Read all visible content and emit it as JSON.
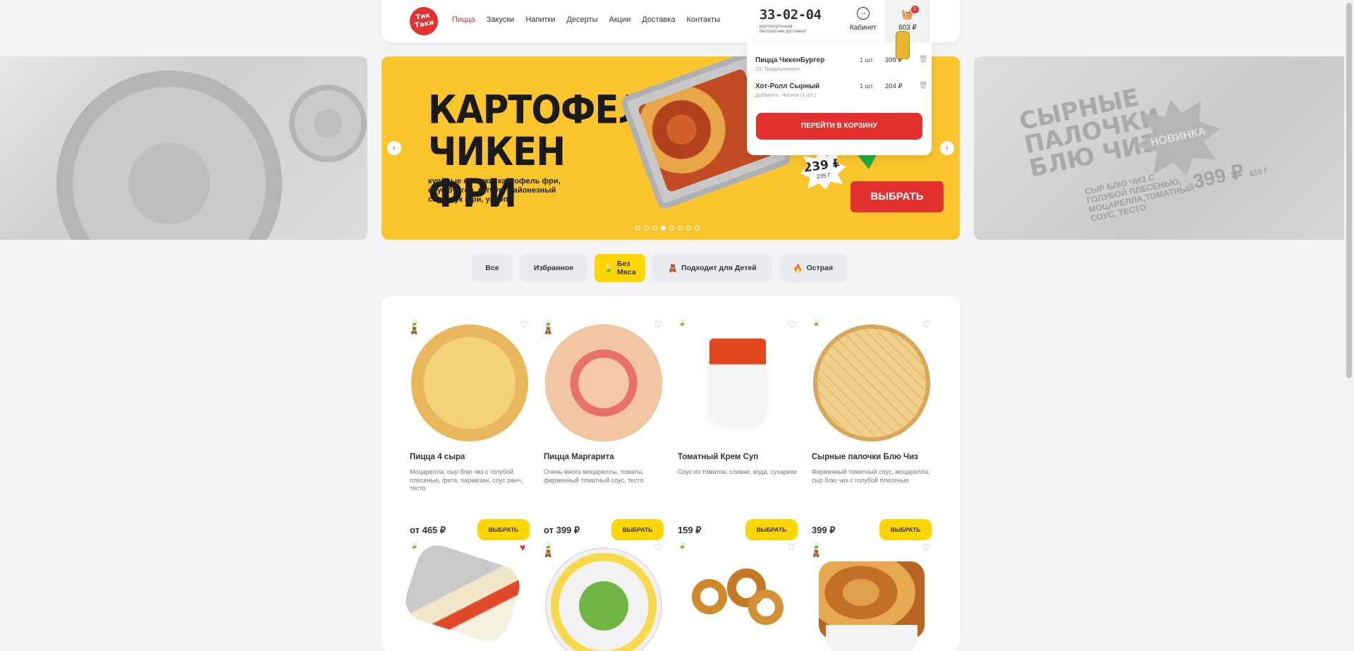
{
  "header": {
    "nav": [
      "Пицца",
      "Закуски",
      "Напитки",
      "Десерты",
      "Акции",
      "Доставка",
      "Контакты"
    ],
    "phone": "33-02-04",
    "phone_sub": "круглосуточная бесплатная доставка*",
    "cabinet": "Кабинет",
    "cart_count": "2",
    "cart_total": "603 ₽"
  },
  "banner": {
    "title": "КАРТОФЕЛЬ ЧИКЕН ФРИ",
    "desc": "куриные кусочки, картофель фри, соус бургер, кетчуп, майонезный соус, лук фри, укроп",
    "price": "239 ₽",
    "weight": "235 Г",
    "button": "ВЫБРАТЬ",
    "right_title": "СЫРНЫЕ ПАЛОЧКИ БЛЮ ЧИЗ",
    "right_badge": "НОВИНКА",
    "right_desc": "СЫР БЛЮ ЧИЗ С ГОЛУБОЙ ПЛЕСЕНЬЮ, МОЦАРЕЛЛА,ТОМАТНЫЙ СОУС, ТЕСТО",
    "right_price": "399 ₽",
    "right_weight": "510 Г",
    "active_slide": 4,
    "slides": 8
  },
  "cart_dropdown": {
    "items": [
      {
        "name": "Пицца ЧикенБургер",
        "sub": "23, Традиционное",
        "qty": "1 шт.",
        "price": "399 ₽"
      },
      {
        "name": "Хот-Ролл Сырный",
        "sub": "Добавить: Чеснок (1 шт.)",
        "qty": "1 шт.",
        "price": "204 ₽"
      }
    ],
    "button": "ПЕРЕЙТИ В КОРЗИНУ"
  },
  "filters": [
    {
      "label": "Все",
      "icon": "",
      "active": false
    },
    {
      "label": "Избранное",
      "icon": "",
      "active": false
    },
    {
      "label": "Без Мяса",
      "icon": "leaf-icon",
      "active": true
    },
    {
      "label": "Подходит для Детей",
      "icon": "teddy-icon",
      "active": false
    },
    {
      "label": "Острая",
      "icon": "fire-icon",
      "active": false
    }
  ],
  "products": [
    {
      "name": "Пицца 4 сыра",
      "desc": "Моцарелла, сыр блю чиз с голубой плесенью, фета, пармезан, соус ранч, тесто",
      "price": "от 465 ₽",
      "button": "ВЫБРАТЬ",
      "favorite": false
    },
    {
      "name": "Пицца Маргарита",
      "desc": "Очень много моцареллы, томаты, фирменный томатный соус, тесто",
      "price": "от 399 ₽",
      "button": "ВЫБРАТЬ",
      "favorite": false
    },
    {
      "name": "Томатный Крем Суп",
      "desc": "Соус из томатов, сливки, вода, сухарики",
      "price": "159 ₽",
      "button": "ВЫБРАТЬ",
      "favorite": false
    },
    {
      "name": "Сырные палочки Блю Чиз",
      "desc": "Фирменный томатный соус, моцарелла, сыр блю чиз с голубой плесенью",
      "price": "399 ₽",
      "button": "ВЫБРАТЬ",
      "favorite": false
    }
  ],
  "colors": {
    "accent": "#e4312f",
    "yellow": "#ffd600",
    "banner": "#fcc52c"
  }
}
